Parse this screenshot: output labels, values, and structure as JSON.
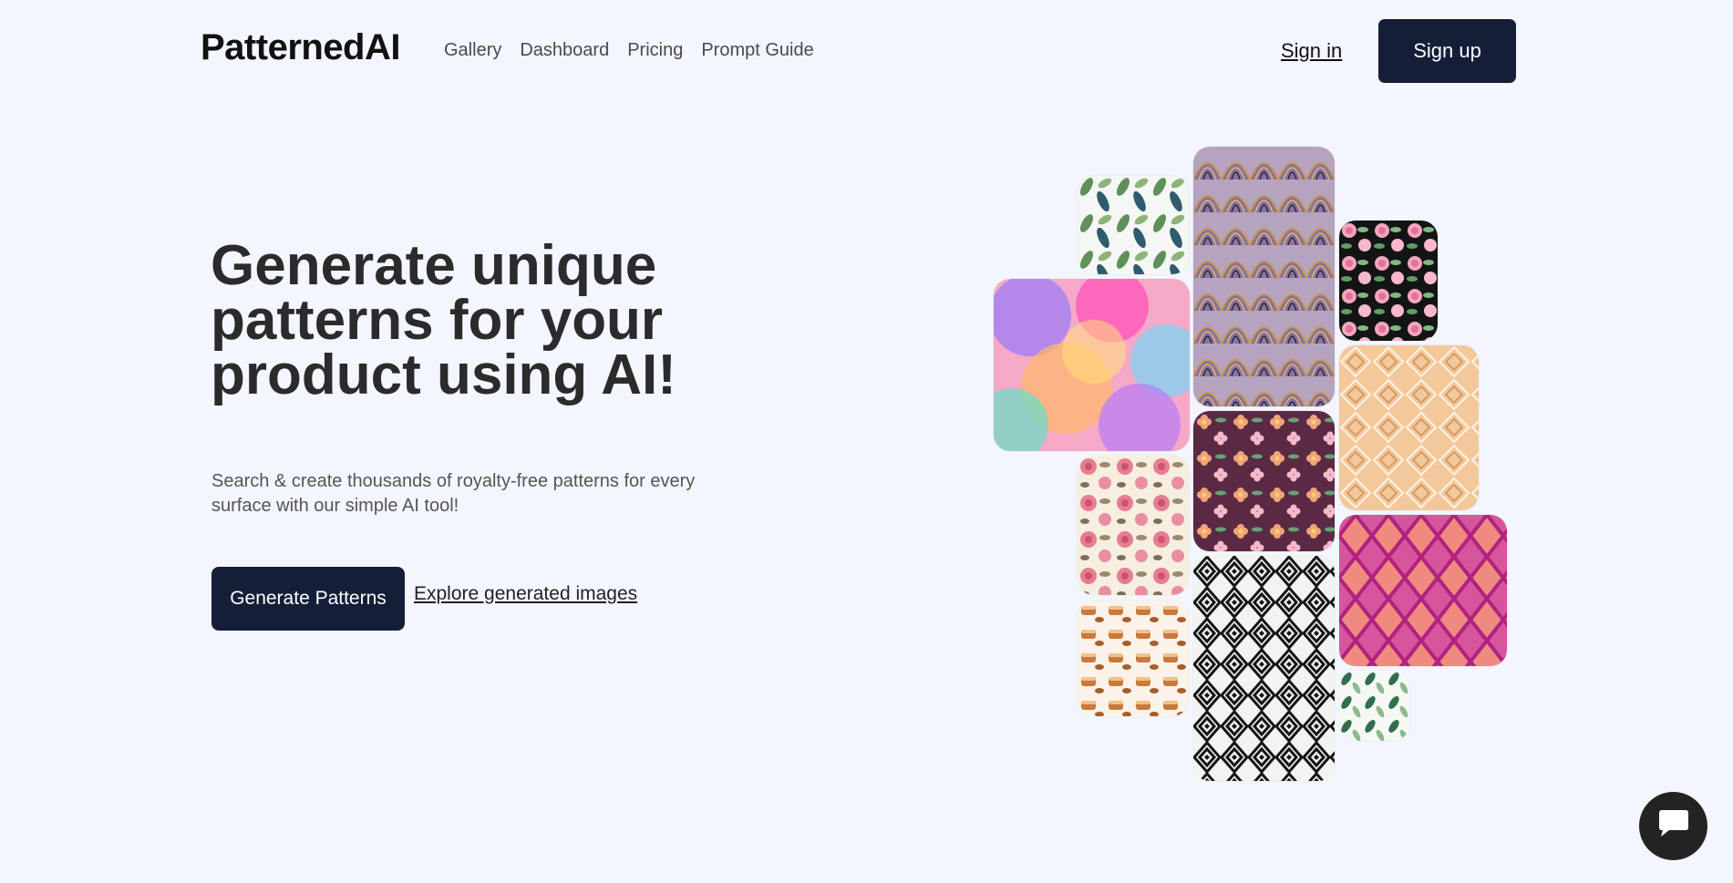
{
  "header": {
    "logo": "PatternedAI",
    "nav": [
      "Gallery",
      "Dashboard",
      "Pricing",
      "Prompt Guide"
    ],
    "sign_in": "Sign in",
    "sign_up": "Sign up"
  },
  "hero": {
    "title": "Generate unique patterns for your product using AI!",
    "subtitle": "Search & create thousands of royalty-free patterns for every surface with our simple AI tool!",
    "primary_cta": "Generate Patterns",
    "secondary_cta": "Explore generated images"
  },
  "gallery": {
    "tiles": [
      {
        "name": "watercolor-leaves-pattern",
        "style": "leaves-blue-green"
      },
      {
        "name": "art-deco-fan-pattern",
        "style": "art-deco"
      },
      {
        "name": "pink-roses-black-pattern",
        "style": "roses-black"
      },
      {
        "name": "colorful-bubbles-pattern",
        "style": "bubbles"
      },
      {
        "name": "peach-geometric-diamond-pattern",
        "style": "peach-diamond"
      },
      {
        "name": "flowers-burgundy-pattern",
        "style": "flowers-burgundy"
      },
      {
        "name": "pink-roses-cream-pattern",
        "style": "roses-cream"
      },
      {
        "name": "magenta-lattice-pattern",
        "style": "magenta-lattice"
      },
      {
        "name": "black-white-diamond-pattern",
        "style": "bw-diamond"
      },
      {
        "name": "pastries-pattern",
        "style": "pastries"
      },
      {
        "name": "green-leaves-small-pattern",
        "style": "leaves-green"
      }
    ]
  },
  "colors": {
    "background": "#f3f6fd",
    "button": "#141e37",
    "chat": "#232323"
  },
  "icons": {
    "chat": "chat-bubble-icon"
  }
}
